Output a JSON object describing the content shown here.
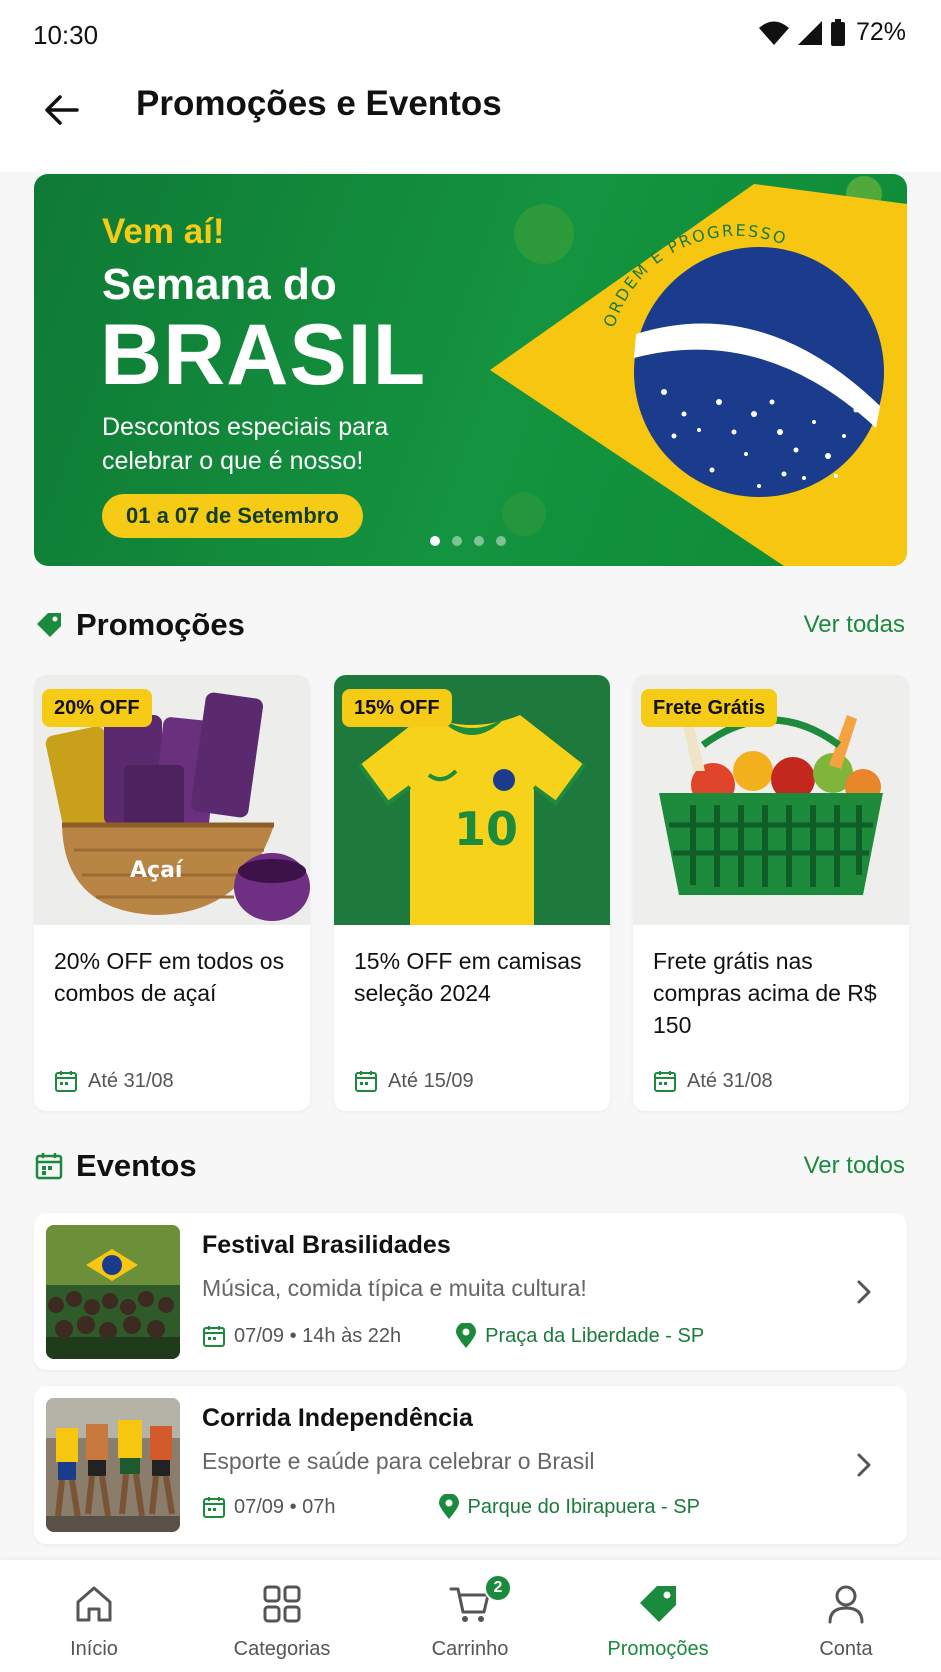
{
  "status_bar": {
    "time": "10:30",
    "battery": "72%"
  },
  "header": {
    "title": "Promoções e Eventos"
  },
  "banner": {
    "pretitle": "Vem aí!",
    "title_line1": "Semana do",
    "title_line2": "BRASIL",
    "description": "Descontos especiais para celebrar o que é nosso!",
    "date_label": "01 a 07 de Setembro",
    "flag_motto": "ORDEM E PROGRESSO",
    "slide_count": 4,
    "active_slide": 1
  },
  "promotions": {
    "title": "Promoções",
    "link": "Ver todas",
    "items": [
      {
        "badge": "20% OFF",
        "text": "20% OFF em todos os combos de açaí",
        "until": "Até 31/08",
        "image_text": "Açaí"
      },
      {
        "badge": "15% OFF",
        "text": "15% OFF em camisas seleção 2024",
        "until": "Até 15/09",
        "image_text": "10"
      },
      {
        "badge": "Frete Grátis",
        "text": "Frete grátis nas compras acima de R$ 150",
        "until": "Até 31/08"
      }
    ]
  },
  "events": {
    "title": "Eventos",
    "link": "Ver todos",
    "items": [
      {
        "title": "Festival Brasilidades",
        "desc": "Música, comida típica e muita cultura!",
        "when": "07/09 • 14h às 22h",
        "where": "Praça da Liberdade - SP"
      },
      {
        "title": "Corrida Independência",
        "desc": "Esporte e saúde para celebrar o Brasil",
        "when": "07/09 • 07h",
        "where": "Parque do Ibirapuera - SP"
      }
    ]
  },
  "bottom_nav": {
    "items": [
      {
        "label": "Início",
        "icon": "home-icon"
      },
      {
        "label": "Categorias",
        "icon": "grid-icon"
      },
      {
        "label": "Carrinho",
        "icon": "cart-icon",
        "badge": "2"
      },
      {
        "label": "Promoções",
        "icon": "tag-icon",
        "active": true
      },
      {
        "label": "Conta",
        "icon": "user-icon"
      }
    ]
  },
  "colors": {
    "accent_green": "#1a8a3c",
    "brand_yellow": "#f6cb16",
    "flag_blue": "#1b3c8c"
  }
}
